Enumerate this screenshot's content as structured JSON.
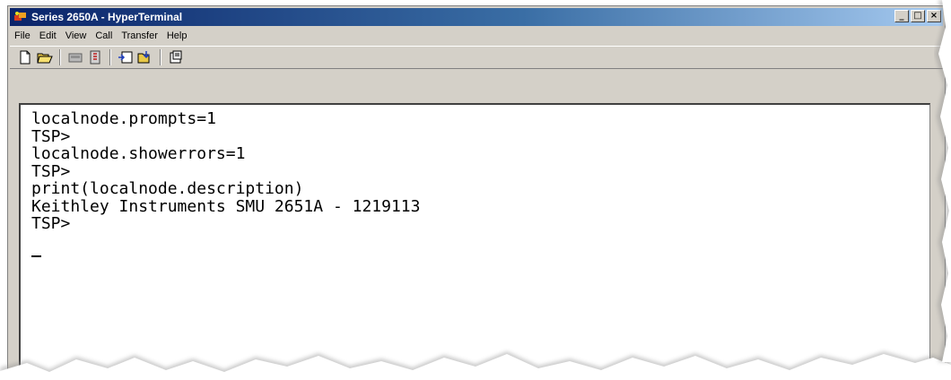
{
  "window": {
    "title": "Series 2650A - HyperTerminal",
    "controls": {
      "minimize": "_",
      "restore": "□",
      "close": "×"
    }
  },
  "menu": {
    "items": [
      "File",
      "Edit",
      "View",
      "Call",
      "Transfer",
      "Help"
    ]
  },
  "toolbar": {
    "icons": [
      "new-icon",
      "open-icon",
      "disconnect-icon",
      "properties-call-icon",
      "send-icon",
      "receive-icon",
      "properties-icon"
    ]
  },
  "terminal": {
    "lines": [
      "localnode.prompts=1",
      "TSP>",
      "localnode.showerrors=1",
      "TSP>",
      "print(localnode.description)",
      "Keithley Instruments SMU 2651A - 1219113",
      "TSP>"
    ]
  },
  "colors": {
    "titlebar_start": "#0a246a",
    "titlebar_end": "#a6caf0",
    "chrome": "#d4d0c8",
    "terminal_bg": "#ffffff",
    "terminal_text": "#000000"
  }
}
